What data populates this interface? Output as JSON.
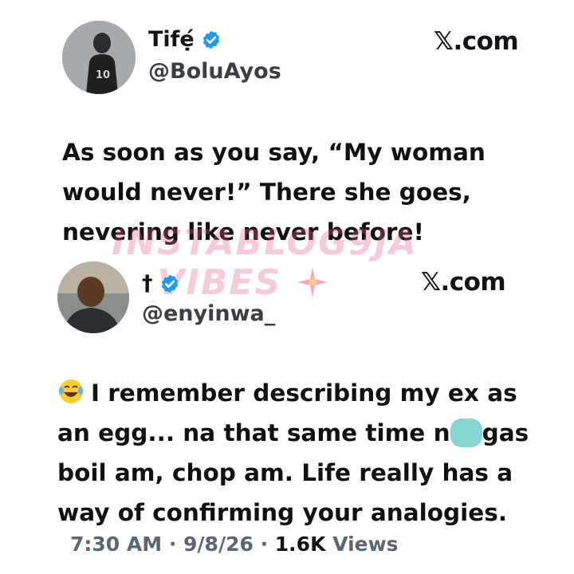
{
  "tweet1": {
    "name": "Tifẹ́",
    "handle": "@BoluAyos",
    "source": "𝕏.com",
    "text_lines": [
      "As soon as you say, “My woman",
      "would never!” There she goes,",
      "nevering like never before!"
    ]
  },
  "watermark": {
    "line1": "INSTABLOG9JA",
    "line2": "VIBES"
  },
  "tweet2": {
    "name": "†",
    "handle": "@enyinwa_",
    "source": "𝕏.com",
    "text_lines": {
      "line1": "I remember describing my ex as",
      "line2_pre": "an egg... na that same time n",
      "line2_post": "gas",
      "line3": "boil am, chop am. Life really has a",
      "line4": "way of confirming your analogies."
    },
    "meta": {
      "time": "7:30 AM",
      "sep1": " · ",
      "date": "9/8/26",
      "sep2": " · ",
      "views_count": "1.6K",
      "views_label": " Views"
    }
  },
  "colors": {
    "verified": "#1d9bf0",
    "watermark": "#e86080",
    "blur": "#6fcfc7"
  },
  "icons": {
    "verified": "verified-badge-icon",
    "laugh": "laughing-tears-emoji",
    "spark": "spark-burst-icon"
  }
}
